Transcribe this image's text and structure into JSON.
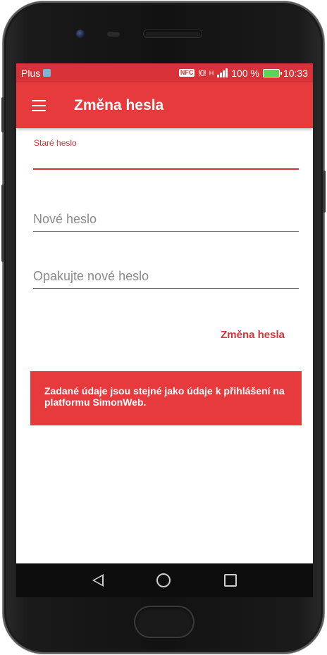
{
  "status_bar": {
    "carrier": "Plus",
    "nfc": "NFC",
    "vibrate": "!0!",
    "network": "H",
    "battery_percent": "100 %",
    "time": "10:33"
  },
  "app_bar": {
    "title": "Změna hesla",
    "menu_icon": "hamburger-menu-icon"
  },
  "form": {
    "old_password": {
      "label": "Staré heslo",
      "value": "",
      "placeholder": ""
    },
    "new_password": {
      "placeholder": "Nové heslo",
      "value": ""
    },
    "repeat_password": {
      "placeholder": "Opakujte nové heslo",
      "value": ""
    },
    "submit_label": "Změna hesla"
  },
  "notice": {
    "text": "Zadané údaje jsou stejné jako údaje k přihlášení na platformu SimonWeb."
  },
  "nav_bar": {
    "back_icon": "back-triangle-icon",
    "home_icon": "home-circle-icon",
    "recents_icon": "recents-square-icon"
  },
  "colors": {
    "accent": "#e63a3c",
    "status_bar": "#d63238",
    "text_muted": "#8a8a8a"
  }
}
